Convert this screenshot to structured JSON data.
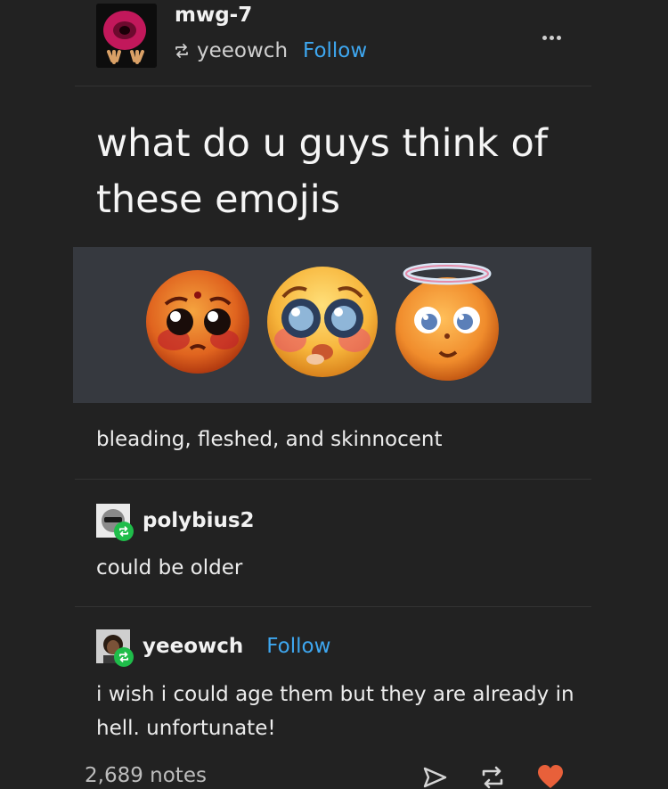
{
  "post": {
    "blog_name": "mwg-7",
    "reblogged_from": "yeeowch",
    "follow_label": "Follow",
    "title": "what do u guys think of these emojis",
    "caption": "bleading, fleshed, and skinnocent"
  },
  "replies": [
    {
      "username": "polybius2",
      "text": "could be older"
    },
    {
      "username": "yeeowch",
      "follow_label": "Follow",
      "text": "i wish i could age them but they are already in hell. unfortunate!"
    }
  ],
  "footer": {
    "notes": "2,689 notes"
  },
  "icons": {
    "menu": "more-dots-icon",
    "reblog": "reblog-icon",
    "share": "send-icon",
    "like": "heart-icon"
  },
  "colors": {
    "background": "#222222",
    "follow_link": "#3ea7f0",
    "reblog_badge": "#1fbd4a",
    "like_heart": "#e8603a",
    "image_bg": "#36393f"
  }
}
